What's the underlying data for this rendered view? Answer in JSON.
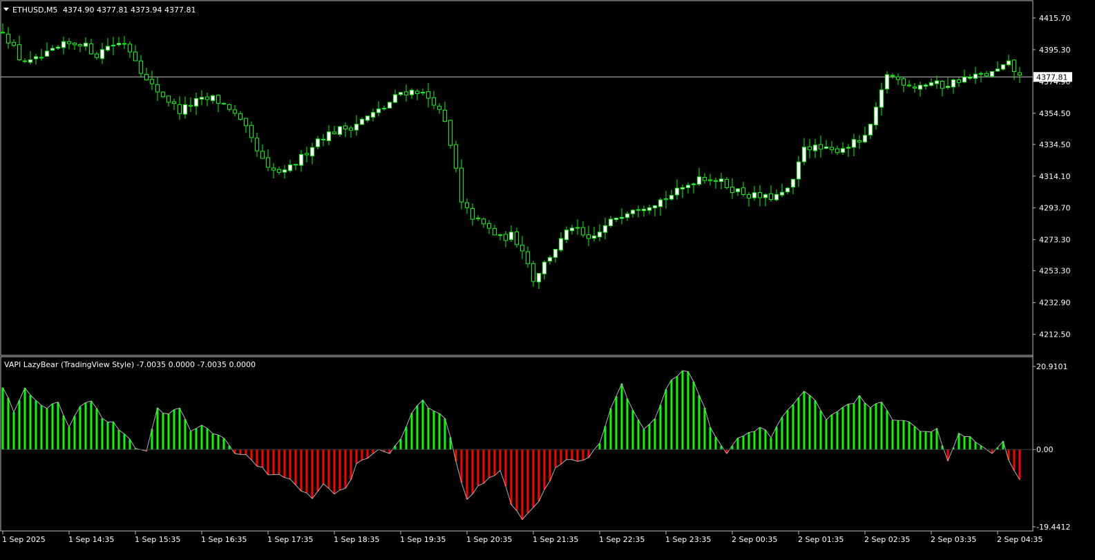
{
  "colors": {
    "background": "#000000",
    "frame": "#c0c0c0",
    "candle": "#00ff00",
    "candle_bull_body": "#ffffff",
    "candle_bear_body": "#000000",
    "vapi_positive": "#00ff00",
    "vapi_negative": "#ff0000",
    "vapi_line": "#b4b4b4",
    "text": "#ffffff",
    "price_line": "#c0c0c0"
  },
  "price_chart": {
    "header_icon": "triangle-down-icon",
    "symbol": "ETHUSD,M5",
    "ohlc_text": "4374.90 4377.81 4373.94 4377.81",
    "current_price": 4377.81,
    "current_price_label": "4377.81",
    "axis_ticks": [
      "4415.70",
      "4395.30",
      "4374.90",
      "4354.50",
      "4334.50",
      "4314.10",
      "4293.70",
      "4273.30",
      "4253.30",
      "4232.90",
      "4212.50"
    ],
    "ylim": [
      4207.0,
      4421.0
    ]
  },
  "indicator": {
    "label": "VAPI LazyBear (TradingView Style) -7.0035 0.0000 -7.0035 0.0000",
    "axis_ticks": [
      "20.9101",
      "0.00",
      "-19.4412"
    ],
    "ylim": [
      -19.4412,
      20.9101
    ]
  },
  "time_axis": {
    "labels": [
      "1 Sep 2025",
      "1 Sep 14:35",
      "1 Sep 15:35",
      "1 Sep 16:35",
      "1 Sep 17:35",
      "1 Sep 18:35",
      "1 Sep 19:35",
      "1 Sep 20:35",
      "1 Sep 21:35",
      "1 Sep 22:35",
      "1 Sep 23:35",
      "2 Sep 00:35",
      "2 Sep 01:35",
      "2 Sep 02:35",
      "2 Sep 03:35",
      "2 Sep 04:35"
    ]
  },
  "chart_data": [
    {
      "type": "candlestick",
      "title": "ETHUSD,M5",
      "ylim": [
        4207.0,
        4421.0
      ],
      "x_labels": [
        "1 Sep 2025",
        "1 Sep 14:35",
        "1 Sep 15:35",
        "1 Sep 16:35",
        "1 Sep 17:35",
        "1 Sep 18:35",
        "1 Sep 19:35",
        "1 Sep 20:35",
        "1 Sep 21:35",
        "1 Sep 22:35",
        "1 Sep 23:35",
        "2 Sep 00:35",
        "2 Sep 01:35",
        "2 Sep 02:35",
        "2 Sep 03:35",
        "2 Sep 04:35"
      ],
      "close_anchors": [
        [
          0,
          4408
        ],
        [
          3,
          4390
        ],
        [
          5,
          4387
        ],
        [
          8,
          4392
        ],
        [
          11,
          4398
        ],
        [
          14,
          4400
        ],
        [
          17,
          4392
        ],
        [
          19,
          4398
        ],
        [
          22,
          4400
        ],
        [
          24,
          4390
        ],
        [
          26,
          4375
        ],
        [
          29,
          4366
        ],
        [
          32,
          4356
        ],
        [
          35,
          4362
        ],
        [
          38,
          4364
        ],
        [
          41,
          4358
        ],
        [
          44,
          4344
        ],
        [
          46,
          4330
        ],
        [
          48,
          4318
        ],
        [
          51,
          4316
        ],
        [
          54,
          4326
        ],
        [
          57,
          4338
        ],
        [
          60,
          4343
        ],
        [
          63,
          4346
        ],
        [
          66,
          4352
        ],
        [
          69,
          4358
        ],
        [
          72,
          4368
        ],
        [
          75,
          4369
        ],
        [
          78,
          4362
        ],
        [
          80,
          4348
        ],
        [
          82,
          4318
        ],
        [
          83,
          4296
        ],
        [
          85,
          4288
        ],
        [
          88,
          4280
        ],
        [
          90,
          4274
        ],
        [
          92,
          4276
        ],
        [
          94,
          4268
        ],
        [
          96,
          4248
        ],
        [
          98,
          4258
        ],
        [
          100,
          4268
        ],
        [
          103,
          4282
        ],
        [
          106,
          4272
        ],
        [
          108,
          4278
        ],
        [
          111,
          4288
        ],
        [
          114,
          4294
        ],
        [
          117,
          4296
        ],
        [
          120,
          4300
        ],
        [
          123,
          4306
        ],
        [
          126,
          4314
        ],
        [
          129,
          4312
        ],
        [
          132,
          4306
        ],
        [
          135,
          4302
        ],
        [
          138,
          4300
        ],
        [
          141,
          4302
        ],
        [
          143,
          4310
        ],
        [
          145,
          4334
        ],
        [
          147,
          4332
        ],
        [
          150,
          4330
        ],
        [
          153,
          4334
        ],
        [
          156,
          4338
        ],
        [
          158,
          4356
        ],
        [
          160,
          4380
        ],
        [
          162,
          4376
        ],
        [
          165,
          4372
        ],
        [
          168,
          4374
        ],
        [
          170,
          4372
        ],
        [
          173,
          4376
        ],
        [
          176,
          4378
        ],
        [
          179,
          4380
        ],
        [
          182,
          4386
        ],
        [
          184,
          4377.81
        ]
      ]
    },
    {
      "type": "bar",
      "title": "VAPI LazyBear (TradingView Style)",
      "ylim": [
        -19.4412,
        20.9101
      ],
      "value_anchors": [
        [
          0,
          16
        ],
        [
          2,
          10
        ],
        [
          4,
          15
        ],
        [
          6,
          12
        ],
        [
          8,
          10
        ],
        [
          10,
          12
        ],
        [
          12,
          6
        ],
        [
          14,
          11
        ],
        [
          16,
          12
        ],
        [
          18,
          8
        ],
        [
          20,
          7
        ],
        [
          22,
          4
        ],
        [
          24,
          0.3
        ],
        [
          26,
          -0.4
        ],
        [
          28,
          10
        ],
        [
          30,
          9
        ],
        [
          32,
          10
        ],
        [
          34,
          5
        ],
        [
          36,
          6
        ],
        [
          38,
          4
        ],
        [
          40,
          3
        ],
        [
          42,
          -1
        ],
        [
          44,
          -1.5
        ],
        [
          46,
          -4
        ],
        [
          48,
          -6
        ],
        [
          50,
          -6
        ],
        [
          52,
          -8
        ],
        [
          54,
          -10
        ],
        [
          56,
          -12
        ],
        [
          58,
          -9
        ],
        [
          60,
          -11
        ],
        [
          62,
          -10
        ],
        [
          64,
          -4
        ],
        [
          66,
          -2
        ],
        [
          68,
          0
        ],
        [
          70,
          -1
        ],
        [
          72,
          3
        ],
        [
          74,
          9
        ],
        [
          76,
          12
        ],
        [
          78,
          10
        ],
        [
          80,
          8
        ],
        [
          82,
          -3
        ],
        [
          84,
          -13
        ],
        [
          86,
          -9
        ],
        [
          88,
          -7
        ],
        [
          90,
          -5
        ],
        [
          92,
          -14
        ],
        [
          94,
          -17
        ],
        [
          96,
          -15
        ],
        [
          98,
          -10
        ],
        [
          100,
          -5
        ],
        [
          102,
          -2
        ],
        [
          104,
          -3
        ],
        [
          106,
          -2
        ],
        [
          108,
          2
        ],
        [
          110,
          10
        ],
        [
          112,
          16
        ],
        [
          114,
          10
        ],
        [
          116,
          5
        ],
        [
          118,
          8
        ],
        [
          120,
          15
        ],
        [
          122,
          19
        ],
        [
          124,
          20
        ],
        [
          126,
          14
        ],
        [
          128,
          6
        ],
        [
          130,
          1
        ],
        [
          131,
          -1
        ],
        [
          133,
          3
        ],
        [
          135,
          4
        ],
        [
          137,
          6
        ],
        [
          139,
          3
        ],
        [
          141,
          8
        ],
        [
          143,
          11
        ],
        [
          145,
          15
        ],
        [
          147,
          12
        ],
        [
          149,
          8
        ],
        [
          151,
          10
        ],
        [
          153,
          11
        ],
        [
          155,
          13
        ],
        [
          157,
          11
        ],
        [
          159,
          12
        ],
        [
          161,
          8
        ],
        [
          163,
          7
        ],
        [
          165,
          6
        ],
        [
          167,
          4
        ],
        [
          169,
          5
        ],
        [
          171,
          -3
        ],
        [
          173,
          4
        ],
        [
          175,
          3
        ],
        [
          177,
          1
        ],
        [
          179,
          -1
        ],
        [
          181,
          2
        ],
        [
          182,
          -3
        ],
        [
          184,
          -7.0035
        ]
      ]
    }
  ]
}
